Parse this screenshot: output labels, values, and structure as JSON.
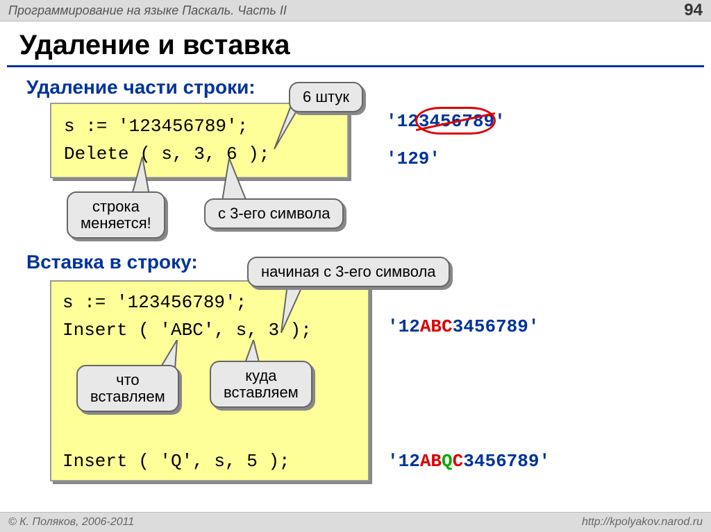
{
  "header": {
    "title": "Программирование на языке Паскаль. Часть II",
    "page_num": "94"
  },
  "slide_title": "Удаление и вставка",
  "section1": {
    "title": "Удаление части строки:",
    "code": "s := '123456789';\nDelete ( s, 3, 6 );",
    "callouts": {
      "count": "6 штук",
      "var_changes": "строка\nменяется!",
      "from_char": "с 3-его символа"
    },
    "result_before": {
      "q1": "'",
      "keep1": "12",
      "del": "345678",
      "keep2": "9",
      "q2": "'"
    },
    "result_after": "'129'"
  },
  "section2": {
    "title": "Вставка в строку:",
    "code_top": "s := '123456789';\nInsert ( 'ABC', s, 3 );",
    "code_bottom": "Insert ( 'Q', s, 5 );",
    "callouts": {
      "start_pos": "начиная с 3-его символа",
      "what": "что\nвставляем",
      "where": "куда\nвставляем"
    },
    "result1": {
      "q1": "'",
      "p1": "12",
      "ins": "ABC",
      "p2": "3456789",
      "q2": "'"
    },
    "result2": {
      "q1": "'",
      "p1": "12",
      "ins1": "AB",
      "ins2": "Q",
      "ins3": "C",
      "p2": "3456789",
      "q2": "'"
    }
  },
  "footer": {
    "copyright": "© К. Поляков, 2006-2011",
    "url": "http://kpolyakov.narod.ru"
  }
}
